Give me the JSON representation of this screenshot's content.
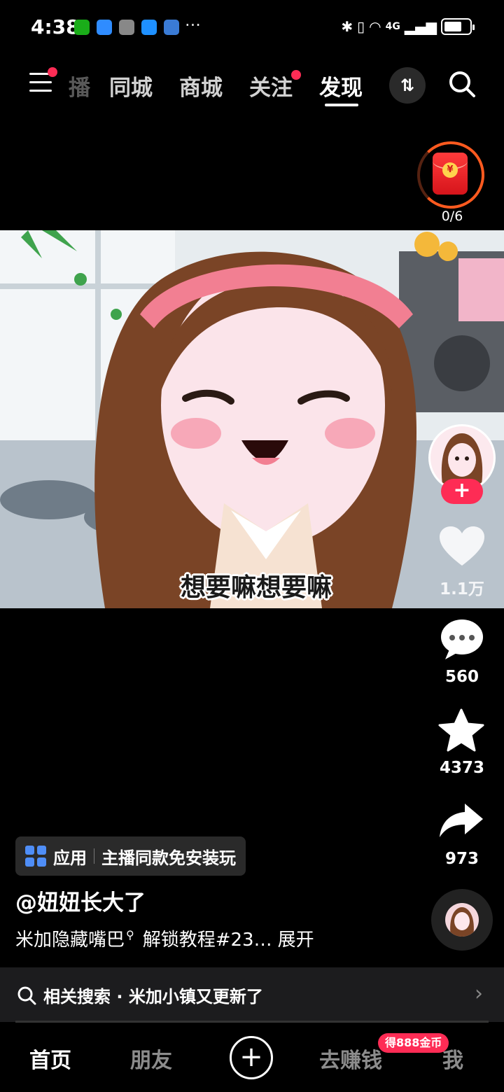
{
  "status_bar": {
    "time": "4:38",
    "more": "···",
    "network": "4G",
    "battery_level": 0.7
  },
  "top_nav": {
    "tabs": [
      {
        "label": "播",
        "state": "faded"
      },
      {
        "label": "同城",
        "state": "normal"
      },
      {
        "label": "商城",
        "state": "normal"
      },
      {
        "label": "关注",
        "state": "normal",
        "badge": true
      },
      {
        "label": "发现",
        "state": "active"
      }
    ]
  },
  "red_packet": {
    "progress": "0/6"
  },
  "video": {
    "subtitle": "想要嘛想要嘛"
  },
  "right_rail": {
    "like_count": "1.1万",
    "comment_count": "560",
    "favorite_count": "4373",
    "share_count": "973",
    "follow_label": "+"
  },
  "caption": {
    "app_tag_label": "应用",
    "app_tag_text": "主播同款免安装玩",
    "author": "@妞妞长大了",
    "description": "米加隐藏嘴巴",
    "description_rest": "解锁教程#23…",
    "expand": "展开"
  },
  "related_search": {
    "text": "相关搜索 · 米加小镇又更新了"
  },
  "playback": {
    "progress": 0.0
  },
  "bottom_nav": {
    "home": "首页",
    "friends": "朋友",
    "create": "+",
    "earn": "去赚钱",
    "earn_badge": "得888金币",
    "me": "我"
  },
  "colors": {
    "accent": "#fe2c55",
    "background": "#000000",
    "panel": "#1c1c1e"
  }
}
